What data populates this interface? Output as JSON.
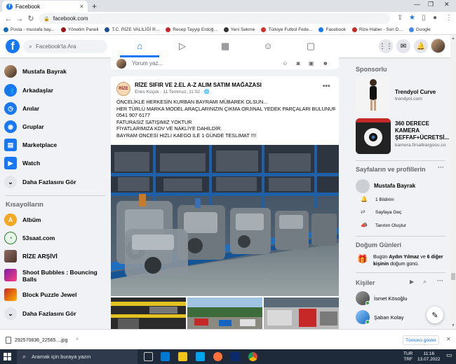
{
  "browser": {
    "tab_title": "Facebook",
    "tab_close": "×",
    "new_tab": "+",
    "window_controls": [
      "—",
      "❐",
      "✕"
    ],
    "url": "facebook.com",
    "bookmarks": [
      {
        "label": "Posta - mustafa bay...",
        "color": "#0f6cbd"
      },
      {
        "label": "Yönetim Paneli",
        "color": "#a01515"
      },
      {
        "label": "T.C. RİZE VALİLİĞİ R...",
        "color": "#1b4e9b"
      },
      {
        "label": "Recep Tayyip Erdoğ...",
        "color": "#c62828"
      },
      {
        "label": "Yeni Sekme",
        "color": "#333333"
      },
      {
        "label": "Türkiye Futbol Fede...",
        "color": "#d32f2f"
      },
      {
        "label": "Facebook",
        "color": "#1877f2"
      },
      {
        "label": "Rize Haber - Son D...",
        "color": "#c62828"
      },
      {
        "label": "Google",
        "color": "#4285f4"
      }
    ]
  },
  "header": {
    "logo": "f",
    "search_placeholder": "Facebook'ta Ara"
  },
  "left_nav": {
    "items": [
      {
        "label": "Mustafa Bayrak",
        "icon": "avatar",
        "color": "#6d4c41"
      },
      {
        "label": "Arkadaşlar",
        "icon": "friends-icon",
        "color": "#1877f2"
      },
      {
        "label": "Anılar",
        "icon": "clock-icon",
        "color": "#1877f2"
      },
      {
        "label": "Gruplar",
        "icon": "groups-icon",
        "color": "#1877f2"
      },
      {
        "label": "Marketplace",
        "icon": "shop-icon",
        "color": "#1877f2"
      },
      {
        "label": "Watch",
        "icon": "watch-icon",
        "color": "#1877f2"
      },
      {
        "label": "Daha Fazlasını Gör",
        "icon": "chevron-down-icon",
        "color": "#e4e6eb"
      }
    ],
    "shortcuts_title": "Kısayolların",
    "shortcuts": [
      {
        "label": "Albüm",
        "icon": "A",
        "color": "#f5a623"
      },
      {
        "label": "53saat.com",
        "icon": "clock",
        "color": "#2e7d32"
      },
      {
        "label": "RİZE ARŞİVİ",
        "icon": "photo",
        "color": "#8d6e63"
      },
      {
        "label": "Shoot Bubbles : Bouncing",
        "label2": "Balls",
        "icon": "bubbles",
        "color": "#7b1fa2"
      },
      {
        "label": "Block Puzzle Jewel",
        "icon": "puzzle",
        "color": "#c62828"
      },
      {
        "label": "Daha Fazlasını Gör",
        "icon": "chevron-down-icon",
        "color": "#e4e6eb"
      }
    ]
  },
  "composer": {
    "placeholder": "Yorum yaz..."
  },
  "post": {
    "author": "RİZE SIFIR VE 2.EL A-Z ALIM SATIM MAĞAZASI",
    "avatar_text": "RİZE",
    "meta": "Enes Küçük · 11 Temmuz, 11:02 · 🌐",
    "more": "•••",
    "lines": [
      "ÖNCELİKLE HERKESİN KURBAN BAYRAMI MÜBAREK OLSUN...",
      "HER TÜRLÜ MARKA MODEL  ARAÇLARINIZIN ÇIKMA ORJINAL YEDEK PARÇALARI BULUNUR",
      "0541 907 6177",
      "FATURASIZ SATIŞIMIZ YOKTUR",
      "FİYATLARIMIZA KDV VE NAKLİYE DAHİLDİR.",
      "BAYRAM ONCESI HIZLI KAEGO ILE 1 GÜNDE TESLIMAT !!!!"
    ]
  },
  "right": {
    "sponsored_title": "Sponsorlu",
    "ads": [
      {
        "name": "Trendyol Curve",
        "url": "trendyol.com"
      },
      {
        "name": "360 DERECE\nKAMERA\nŞEFFAF+ÜCRETSİ...",
        "name_lines": [
          "360 DERECE",
          "KAMERA",
          "ŞEFFAF+ÜCRETSİ..."
        ],
        "url": "kamera.firsatkargosu.co"
      }
    ],
    "pages_title": "Sayfaların ve profillerin",
    "page_name": "Mustafa Bayrak",
    "page_actions": [
      "1 Bildirim",
      "Sayfaya Geç",
      "Tanıtım Oluştur"
    ],
    "birthdays_title": "Doğum Günleri",
    "birthday_text_pre": "Bugün ",
    "birthday_name": "Aydın Yılmaz",
    "birthday_mid": " ve ",
    "birthday_others": "6 diğer kişinin",
    "birthday_post": " doğum günü.",
    "contacts_title": "Kişiler",
    "contacts": [
      "İsmet Kösoğlu",
      "Şaban Kolay"
    ]
  },
  "download": {
    "filename": "292570836_22565....jpg",
    "show_all": "Tümünü göster",
    "close": "✕"
  },
  "taskbar": {
    "search_placeholder": "Aramak için buraya yazın",
    "lang": "TUR",
    "lang2": "TRF",
    "time": "11:16",
    "date": "13.07.2022"
  }
}
